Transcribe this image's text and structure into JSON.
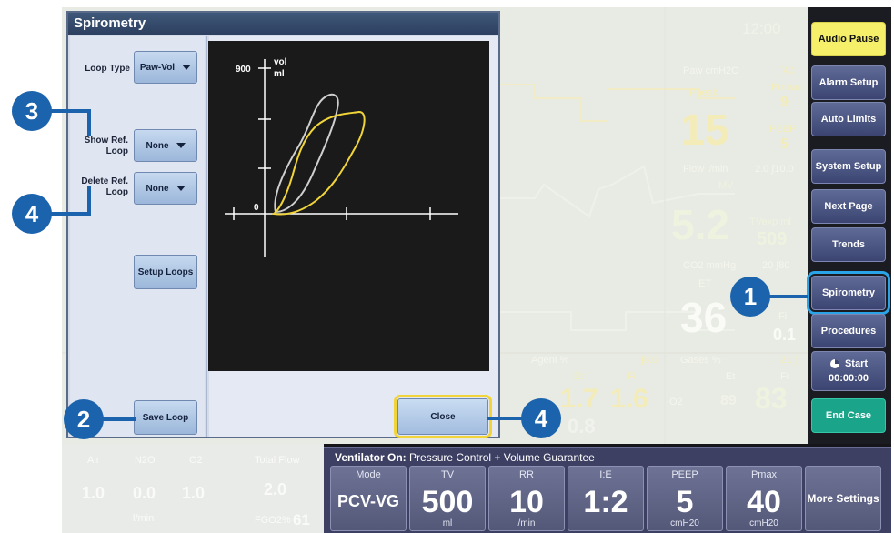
{
  "monitor": {
    "clock": "12:00",
    "paw_label": "Paw cmH2O",
    "paw_limit": "∫40",
    "ppeak_label": "Ppeak",
    "ppeak_value": "15",
    "pmean_label": "Pmean",
    "pmean_value": "9",
    "peep_label": "PEEP",
    "peep_value": "5",
    "flow_label": "Flow l/min",
    "flow_range": "2.0 ∫10.0",
    "mv_label": "MV",
    "mv_value": "5.2",
    "tvexp_label": "TVexp ml",
    "tvexp_value": "509",
    "co2_label": "CO2 mmHg",
    "co2_range": "20 ∫80",
    "et_label": "ET",
    "et_value": "36",
    "fi_label": "Fi",
    "fi_value": "0.1",
    "agent_label": "Agent %",
    "agent_range": "∫8.0",
    "agent_et_label": "Et",
    "agent_fi_label": "Fi",
    "agent_et_value": "1.7",
    "agent_fi_value": "1.6",
    "agent_extra": "0.8",
    "gases_label": "Gases %",
    "gases_range": "21 ∫",
    "gases_et_label": "Et",
    "gases_fi_label": "Fi",
    "o2_label": "O2",
    "o2_et_value": "89",
    "o2_fi_value": "83"
  },
  "gas_panel": {
    "air_label": "Air",
    "n2o_label": "N2O",
    "o2_label": "O2",
    "air_value": "1.0",
    "n2o_value": "0.0",
    "o2_value": "1.0",
    "unit": "l/min",
    "total_flow_label": "Total Flow",
    "total_flow_value": "2.0",
    "fgo2_label": "FGO2%",
    "fgo2_value": "61"
  },
  "right_buttons": {
    "audio_pause": "Audio Pause",
    "alarm_setup": "Alarm Setup",
    "auto_limits": "Auto Limits",
    "system_setup": "System Setup",
    "next_page": "Next Page",
    "trends": "Trends",
    "spirometry": "Spirometry",
    "procedures": "Procedures",
    "start": "Start",
    "start_timer": "00:00:00",
    "end_case": "End Case"
  },
  "ventilator": {
    "status_bold": "Ventilator On:",
    "status_text": "Pressure Control + Volume Guarantee",
    "boxes": [
      {
        "label": "Mode",
        "value": "PCV-VG",
        "unit": ""
      },
      {
        "label": "TV",
        "value": "500",
        "unit": "ml"
      },
      {
        "label": "RR",
        "value": "10",
        "unit": "/min"
      },
      {
        "label": "I:E",
        "value": "1:2",
        "unit": ""
      },
      {
        "label": "PEEP",
        "value": "5",
        "unit": "cmH20"
      },
      {
        "label": "Pmax",
        "value": "40",
        "unit": "cmH20"
      }
    ],
    "more_settings": "More Settings"
  },
  "dialog": {
    "title": "Spirometry",
    "loop_type_label": "Loop Type",
    "loop_type_value": "Paw-Vol",
    "show_ref_label": "Show Ref. Loop",
    "show_ref_value": "None",
    "delete_ref_label": "Delete Ref. Loop",
    "delete_ref_value": "None",
    "setup_loops": "Setup Loops",
    "save_loop": "Save Loop",
    "close": "Close",
    "plot": {
      "y_max": "900",
      "y_unit_top": "vol",
      "y_unit_bottom": "ml",
      "origin": "0"
    }
  },
  "callouts": {
    "c1": "1",
    "c2": "2",
    "c3": "3",
    "c4a": "4",
    "c4b": "4"
  },
  "colors": {
    "accent_blue": "#1b64ad",
    "highlight": "#2aa4e6",
    "loop_current": "#f1d43a",
    "loop_reference": "#cfcfcf",
    "end_case_green": "#1aa58a"
  }
}
